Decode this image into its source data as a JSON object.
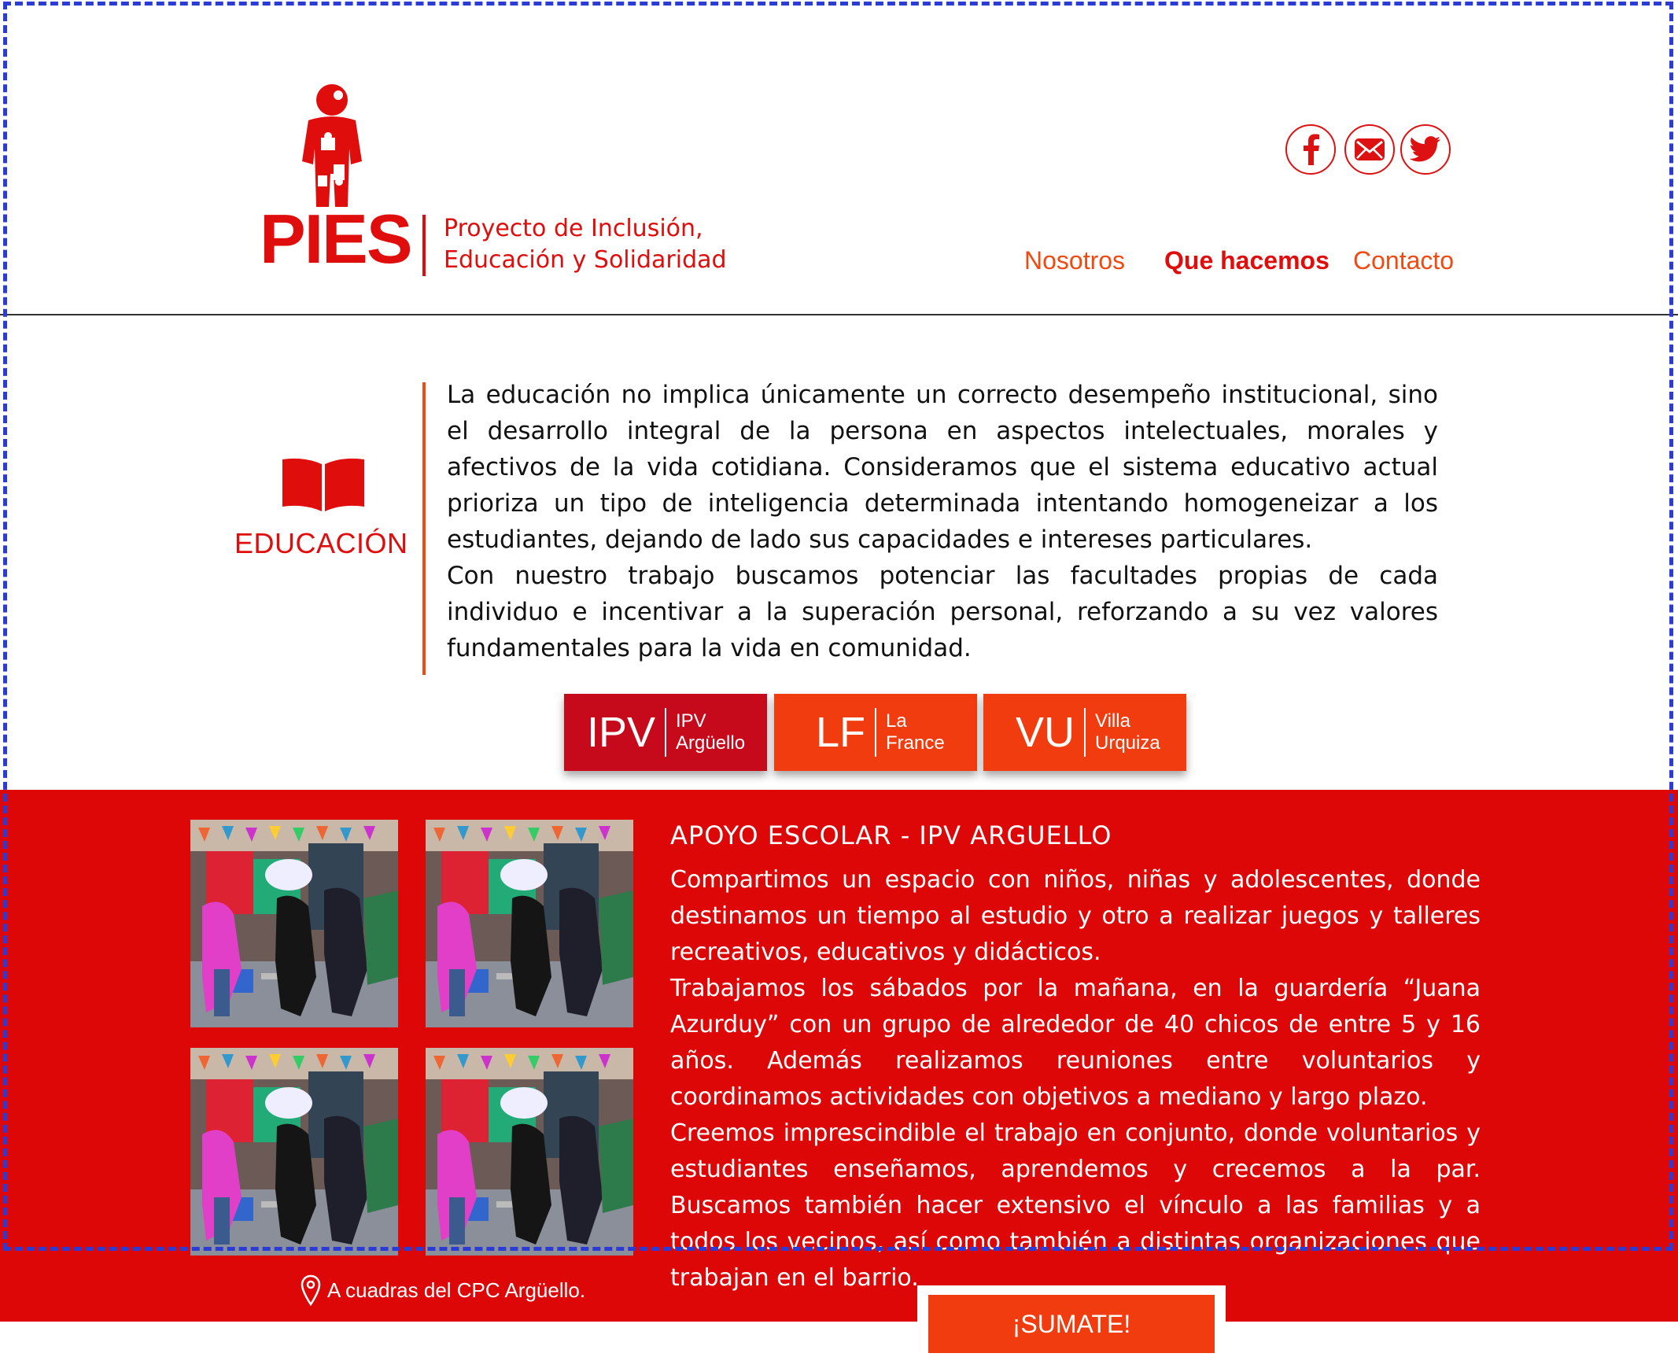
{
  "brand": {
    "name": "PIES",
    "tagline_line1": "Proyecto de Inclusión,",
    "tagline_line2": "Educación y Solidaridad",
    "color": "#e00d0d"
  },
  "social": [
    {
      "icon": "facebook-icon",
      "glyph": "f"
    },
    {
      "icon": "mail-icon",
      "glyph": "✉"
    },
    {
      "icon": "twitter-icon",
      "glyph": "bird"
    }
  ],
  "nav": {
    "items": [
      {
        "label": "Nosotros",
        "active": false
      },
      {
        "label": "Que hacemos",
        "active": true
      },
      {
        "label": "Contacto",
        "active": false
      }
    ]
  },
  "education": {
    "title": "EDUCACIÓN",
    "icon": "book-icon",
    "paragraph1": "La educación no implica únicamente un correcto desempeño institucional, sino el desarrollo integral de la persona en aspectos intelectuales, morales y afectivos de la vida cotidiana. Consideramos que el sistema educativo actual prioriza un tipo de inteligencia determinada intentando homogeneizar a los estudiantes, dejando de lado sus capacidades e intereses particulares.",
    "paragraph2": "Con nuestro trabajo buscamos potenciar las facultades propias de cada individuo e incentivar a la superación personal, reforzando a su vez valores fundamentales para la vida en comunidad."
  },
  "locations": [
    {
      "abbr": "IPV",
      "line1": "IPV",
      "line2": "Argüello",
      "color": "#c60a1c",
      "selected": true
    },
    {
      "abbr": "LF",
      "line1": "La",
      "line2": "France",
      "color": "#f03c0f",
      "selected": false
    },
    {
      "abbr": "VU",
      "line1": "Villa",
      "line2": "Urquiza",
      "color": "#f03c0f",
      "selected": false
    }
  ],
  "program": {
    "title": "APOYO ESCOLAR - IPV ARGUELLO",
    "paragraph1": "Compartimos un espacio con niños, niñas y adolescentes, donde destinamos un tiempo al estudio y otro a realizar juegos y talleres recreativos, educativos y didácticos.",
    "paragraph2": "Trabajamos los sábados por la mañana, en la guardería “Juana Azurduy” con un grupo de alrededor de 40 chicos de entre 5 y 16 años. Además realizamos reuniones entre voluntarios y coordinamos actividades con objetivos a mediano y largo plazo.",
    "paragraph3": "Creemos imprescindible el trabajo en conjunto, donde voluntarios y estudiantes enseñamos, aprendemos y crecemos a la par. Buscamos también hacer extensivo el vínculo a las familias y a todos los vecinos, así como también a distintas organizaciones que trabajan en el barrio.",
    "band_color": "#dd0707"
  },
  "footer": {
    "location_text": "A cuadras del CPC Argüello.",
    "cta_label": "¡SUMATE!"
  }
}
